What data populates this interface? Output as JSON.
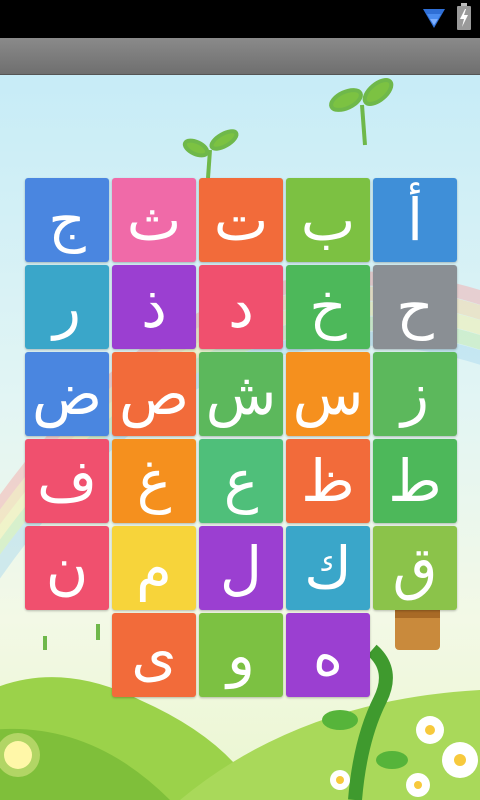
{
  "status_bar": {
    "wifi_icon": "wifi-icon",
    "battery_icon": "battery-charging-icon"
  },
  "title_bar": {
    "title": ""
  },
  "letters": [
    {
      "char": "ج",
      "color": "#4a86e0"
    },
    {
      "char": "ث",
      "color": "#f06aa8"
    },
    {
      "char": "ت",
      "color": "#f26b3a"
    },
    {
      "char": "ب",
      "color": "#7cc142"
    },
    {
      "char": "أ",
      "color": "#3f8fd8"
    },
    {
      "char": "ر",
      "color": "#3aa6c9"
    },
    {
      "char": "ذ",
      "color": "#9b3fd1"
    },
    {
      "char": "د",
      "color": "#f0506e"
    },
    {
      "char": "خ",
      "color": "#4db85a"
    },
    {
      "char": "ح",
      "color": "#8a8f94"
    },
    {
      "char": "ض",
      "color": "#4a86e0"
    },
    {
      "char": "ص",
      "color": "#f26b3a"
    },
    {
      "char": "ش",
      "color": "#5cb85c"
    },
    {
      "char": "س",
      "color": "#f5901e"
    },
    {
      "char": "ز",
      "color": "#5cb85c"
    },
    {
      "char": "ف",
      "color": "#f0506e"
    },
    {
      "char": "غ",
      "color": "#f5901e"
    },
    {
      "char": "ع",
      "color": "#4fbf7a"
    },
    {
      "char": "ظ",
      "color": "#f26b3a"
    },
    {
      "char": "ط",
      "color": "#4db85a"
    },
    {
      "char": "ن",
      "color": "#f0506e"
    },
    {
      "char": "م",
      "color": "#f7d43a"
    },
    {
      "char": "ل",
      "color": "#9b3fd1"
    },
    {
      "char": "ك",
      "color": "#3aa6c9"
    },
    {
      "char": "ق",
      "color": "#8bc34a"
    },
    {
      "char": "ى",
      "color": "#f26b3a"
    },
    {
      "char": "و",
      "color": "#7cc142"
    },
    {
      "char": "ه",
      "color": "#9b3fd1"
    }
  ]
}
